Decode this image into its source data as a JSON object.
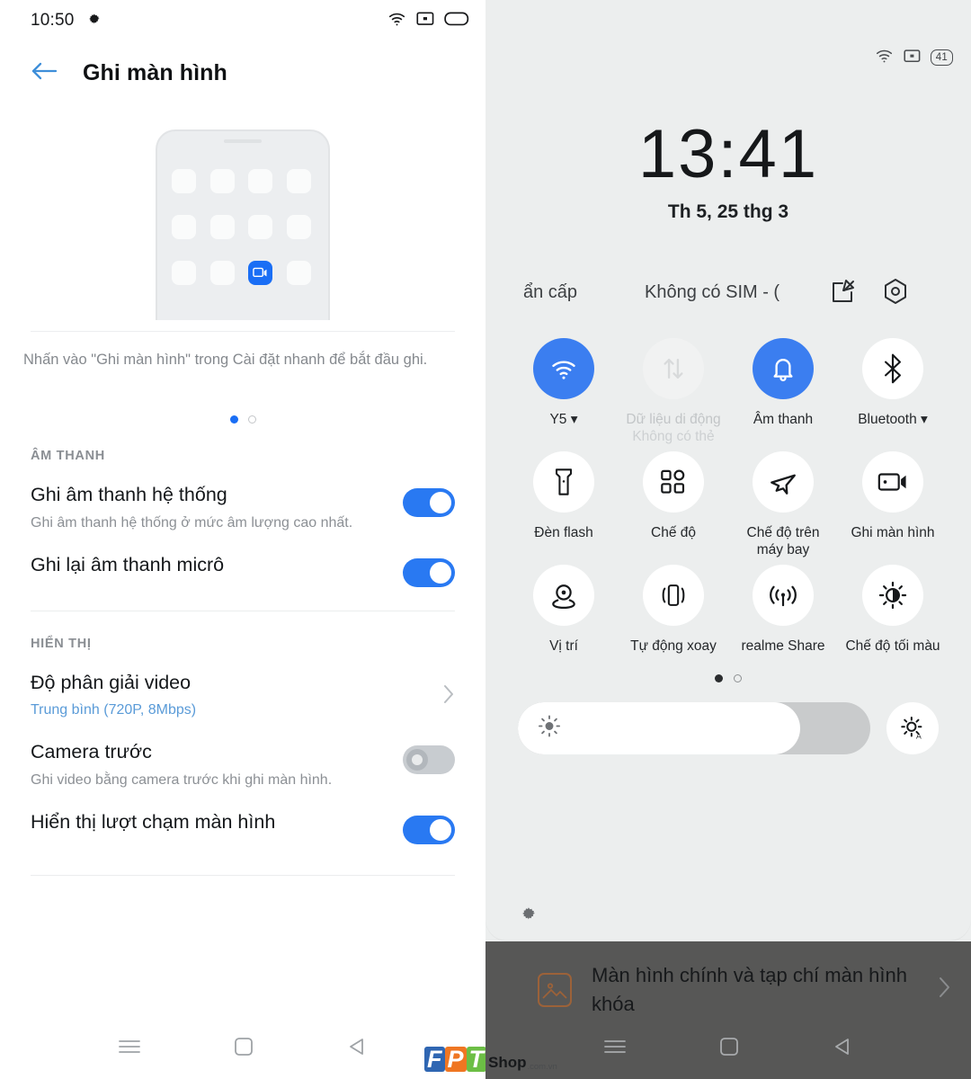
{
  "left": {
    "status_bar": {
      "time": "10:50",
      "icons": [
        "gear-icon",
        "wifi-icon",
        "screencast-icon",
        "battery-icon"
      ]
    },
    "appbar": {
      "back": "back-arrow-icon",
      "title": "Ghi màn hình"
    },
    "hero": {
      "caption": "Nhấn vào \"Ghi màn hình\" trong Cài đặt nhanh để bắt đầu ghi.",
      "page_dots": 2,
      "active_dot": 1
    },
    "sections": [
      {
        "header": "ÂM THANH",
        "rows": [
          {
            "title": "Ghi âm thanh hệ thống",
            "subtitle": "Ghi âm thanh hệ thống ở mức âm lượng cao nhất.",
            "control": "toggle",
            "state": "on"
          },
          {
            "title": "Ghi lại âm thanh micrô",
            "subtitle": "",
            "control": "toggle",
            "state": "on"
          }
        ]
      },
      {
        "header": "HIỂN THỊ",
        "rows": [
          {
            "title": "Độ phân giải video",
            "subtitle": "Trung bình (720P, 8Mbps)",
            "control": "chevron",
            "state": ""
          },
          {
            "title": "Camera trước",
            "subtitle": "Ghi video bằng camera trước khi ghi màn hình.",
            "control": "toggle",
            "state": "off"
          },
          {
            "title": "Hiển thị lượt chạm màn hình",
            "subtitle": "",
            "control": "toggle",
            "state": "on"
          }
        ]
      }
    ],
    "navbar": [
      "menu-icon",
      "home-icon",
      "back-icon"
    ]
  },
  "right": {
    "status_bar": {
      "battery_percent": "41",
      "icons": [
        "wifi-icon",
        "screencast-icon",
        "battery-icon"
      ]
    },
    "clock": {
      "time": "13:41",
      "date": "Th 5, 25 thg 3"
    },
    "header": {
      "emergency": "ẩn cấp",
      "sim": "Không có SIM - (",
      "edit_icon": "edit-icon",
      "settings_icon": "gear-hex-icon"
    },
    "tiles": [
      {
        "label": "Y5",
        "caret": "▾",
        "sublabel": "",
        "icon": "wifi-icon",
        "state": "active"
      },
      {
        "label": "Dữ liệu di động",
        "caret": "",
        "sublabel": "Không có thẻ",
        "icon": "mobile-data-icon",
        "state": "disabled"
      },
      {
        "label": "Âm thanh",
        "caret": "",
        "sublabel": "",
        "icon": "bell-icon",
        "state": "active"
      },
      {
        "label": "Bluetooth",
        "caret": "▾",
        "sublabel": "",
        "icon": "bluetooth-icon",
        "state": "default"
      },
      {
        "label": "Đèn flash",
        "caret": "",
        "sublabel": "",
        "icon": "flashlight-icon",
        "state": "default"
      },
      {
        "label": "Chế độ",
        "caret": "",
        "sublabel": "",
        "icon": "grid-icon",
        "state": "default"
      },
      {
        "label": "Chế độ trên máy bay",
        "caret": "",
        "sublabel": "",
        "icon": "airplane-icon",
        "state": "default"
      },
      {
        "label": "Ghi màn hình",
        "caret": "",
        "sublabel": "",
        "icon": "screen-record-icon",
        "state": "default"
      },
      {
        "label": "Vị trí",
        "caret": "",
        "sublabel": "",
        "icon": "location-pin-icon",
        "state": "default"
      },
      {
        "label": "Tự động xoay",
        "caret": "",
        "sublabel": "",
        "icon": "auto-rotate-icon",
        "state": "default"
      },
      {
        "label": "realme Share",
        "caret": "",
        "sublabel": "",
        "icon": "share-broadcast-icon",
        "state": "default"
      },
      {
        "label": "Chế độ tối màu",
        "caret": "",
        "sublabel": "",
        "icon": "dark-mode-icon",
        "state": "default"
      }
    ],
    "page_dots": {
      "count": 2,
      "active": 1
    },
    "brightness": {
      "level_percent": 80,
      "auto_icon": "auto-brightness-icon",
      "sun_icon": "sun-icon"
    },
    "footer_gear": "gear-icon",
    "notification": {
      "title": "Màn hình chính và tạp chí màn hình khóa",
      "icon": "image-icon",
      "chevron": "chevron-right-icon"
    },
    "navbar": [
      "menu-icon",
      "home-icon",
      "back-icon"
    ]
  },
  "watermark": {
    "f": "F",
    "p": "P",
    "t": "T",
    "shop": "Shop",
    "tld": ".com.vn"
  }
}
